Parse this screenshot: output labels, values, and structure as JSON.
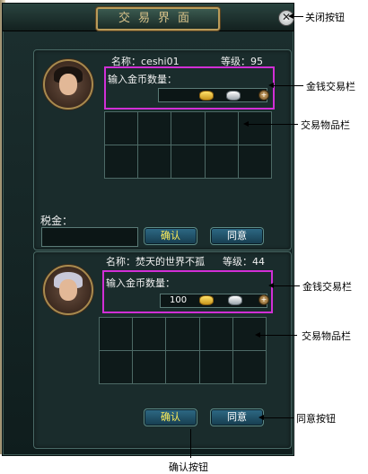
{
  "window": {
    "title": "交易界面",
    "close_icon": "close-icon"
  },
  "self": {
    "name_label": "名称：ceshi01",
    "level_label": "等级：95",
    "money_label": "输入金币数量：",
    "money_value": ""
  },
  "tax_label": "税金：",
  "tax_value": "",
  "buttons": {
    "confirm": "确认",
    "agree": "同意"
  },
  "other": {
    "name_label": "名称：焚天的世界不孤",
    "level_label": "等级：44",
    "money_label": "输入金币数量：",
    "money_value": "100"
  },
  "annotations": {
    "close_button": "关闭按钮",
    "money_bar_top": "金钱交易栏",
    "items_bar_top": "交易物品栏",
    "money_bar_bottom": "金钱交易栏",
    "items_bar_bottom": "交易物品栏",
    "agree_button": "同意按钮",
    "confirm_button": "确认按钮"
  }
}
